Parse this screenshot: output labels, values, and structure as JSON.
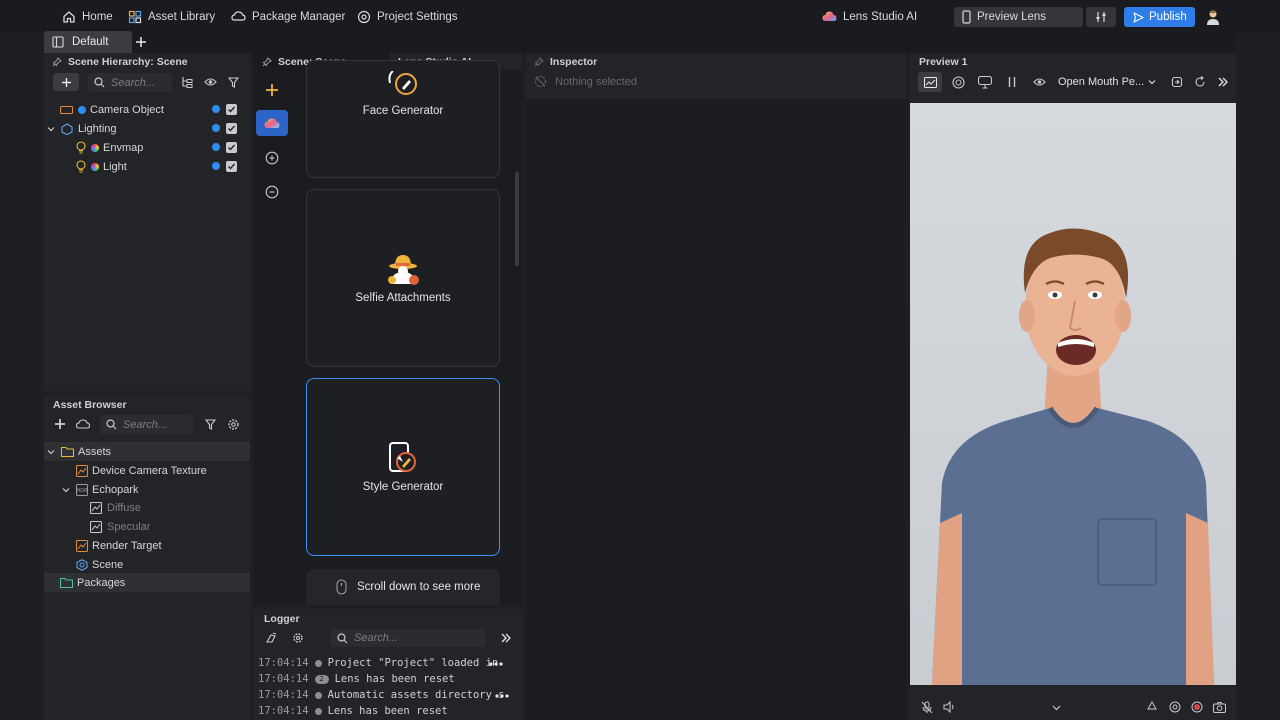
{
  "topbar": {
    "home": "Home",
    "asset_library": "Asset Library",
    "package_manager": "Package Manager",
    "project_settings": "Project Settings",
    "lens_studio_ai": "Lens Studio AI",
    "preview_lens": "Preview Lens",
    "publish": "Publish"
  },
  "workspace_tab": "Default",
  "scene_hierarchy": {
    "title": "Scene Hierarchy: Scene",
    "search_placeholder": "Search...",
    "items": [
      {
        "label": "Camera Object"
      },
      {
        "label": "Lighting"
      },
      {
        "label": "Envmap"
      },
      {
        "label": "Light"
      }
    ]
  },
  "asset_browser": {
    "title": "Asset Browser",
    "search_placeholder": "Search...",
    "items": [
      {
        "label": "Assets"
      },
      {
        "label": "Device Camera Texture"
      },
      {
        "label": "Echopark"
      },
      {
        "label": "Diffuse"
      },
      {
        "label": "Specular"
      },
      {
        "label": "Render Target"
      },
      {
        "label": "Scene"
      },
      {
        "label": "Packages"
      }
    ]
  },
  "scene_tabs": {
    "scene": "Scene: Scene",
    "ai": "Lens Studio AI"
  },
  "ai_cards": {
    "face_generator": "Face Generator",
    "selfie_attachments": "Selfie Attachments",
    "style_generator": "Style Generator",
    "scroll_hint": "Scroll down to see more"
  },
  "logger": {
    "title": "Logger",
    "search_placeholder": "Search...",
    "entries": [
      {
        "time": "17:04:14",
        "badge": "",
        "text": "Project \"Project\" loaded in"
      },
      {
        "time": "17:04:14",
        "badge": "2",
        "text": "Lens has been reset"
      },
      {
        "time": "17:04:14",
        "badge": "",
        "text": "Automatic assets directory s"
      },
      {
        "time": "17:04:14",
        "badge": "",
        "text": "Lens has been reset"
      }
    ]
  },
  "inspector": {
    "title": "Inspector",
    "empty": "Nothing selected"
  },
  "preview": {
    "title": "Preview 1",
    "mode": "Open Mouth Pe..."
  },
  "colors": {
    "accent": "#3e8ef7",
    "blue_dot": "#2f8df0",
    "orange": "#e38a3d",
    "yellow": "#e8b93a"
  }
}
